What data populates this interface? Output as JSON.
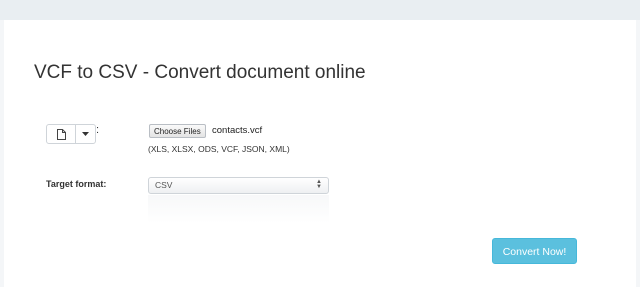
{
  "page": {
    "title": "VCF to CSV - Convert document online"
  },
  "source": {
    "file_icon": "document-icon",
    "caret_icon": "caret-down-icon",
    "colon": ":",
    "choose_label": "Choose Files",
    "file_name": "contacts.vcf",
    "allowed_formats": "(XLS, XLSX, ODS, VCF, JSON, XML)"
  },
  "target": {
    "label": "Target format:",
    "selected": "CSV",
    "arrows_icon": "updown-arrows-icon"
  },
  "actions": {
    "convert_label": "Convert Now!"
  },
  "colors": {
    "accent": "#5bc0de",
    "background": "#f4f6f8",
    "panel": "#ffffff"
  }
}
